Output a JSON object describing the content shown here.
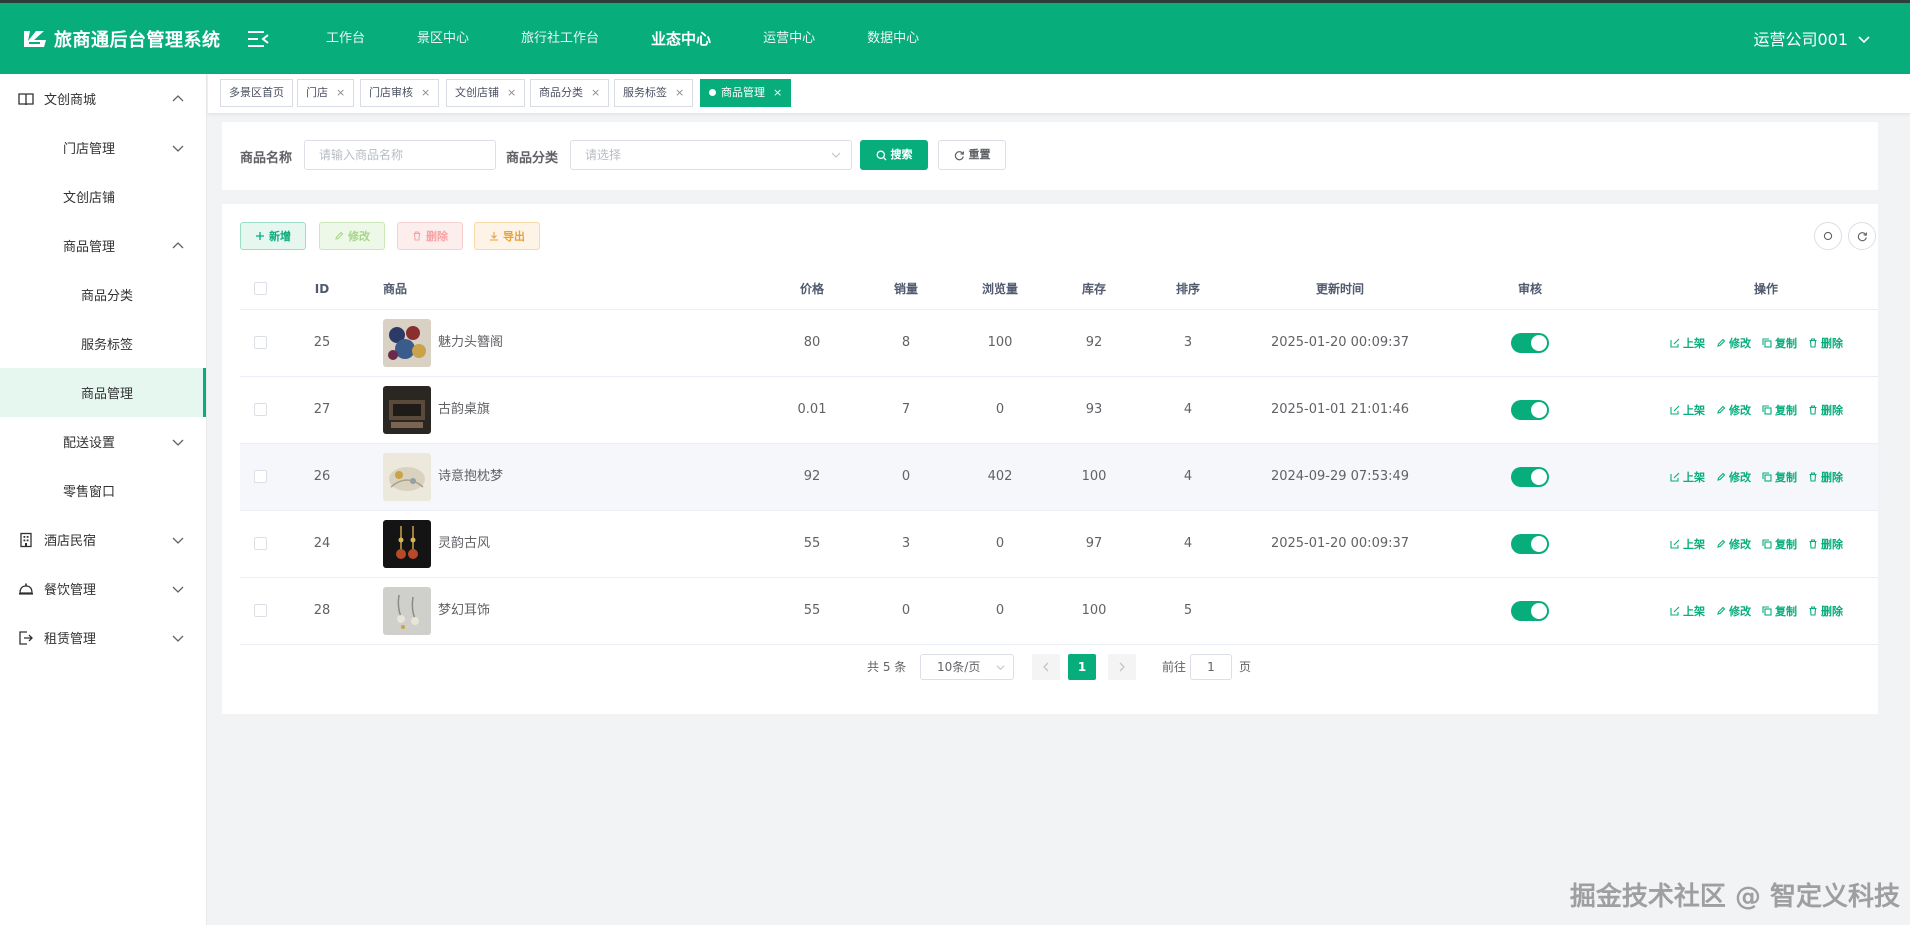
{
  "app": {
    "title": "旅商通后台管理系统",
    "user": "运营公司001"
  },
  "colors": {
    "brand": "#08ad7c",
    "topbar": "#08ad7c"
  },
  "topnav": [
    "工作台",
    "景区中心",
    "旅行社工作台",
    "业态中心",
    "运营中心",
    "数据中心"
  ],
  "topnav_active": "业态中心",
  "sidebar": {
    "items": [
      {
        "label": "文创商城",
        "icon": "book-icon"
      },
      {
        "label": "门店管理"
      },
      {
        "label": "文创店铺"
      },
      {
        "label": "商品管理"
      },
      {
        "label": "商品分类"
      },
      {
        "label": "服务标签"
      },
      {
        "label": "商品管理"
      },
      {
        "label": "配送设置"
      },
      {
        "label": "零售窗口"
      },
      {
        "label": "酒店民宿",
        "icon": "building-icon"
      },
      {
        "label": "餐饮管理",
        "icon": "dining-bell-icon"
      },
      {
        "label": "租赁管理",
        "icon": "logout-box-icon"
      }
    ]
  },
  "tabs": [
    "多景区首页",
    "门店",
    "门店审核",
    "文创店铺",
    "商品分类",
    "服务标签",
    "商品管理"
  ],
  "search": {
    "name_label": "商品名称",
    "name_placeholder": "请输入商品名称",
    "category_label": "商品分类",
    "category_placeholder": "请选择",
    "search_button": "搜索",
    "reset_button": "重置"
  },
  "toolbar": {
    "add": "新增",
    "edit": "修改",
    "delete": "删除",
    "export": "导出"
  },
  "table": {
    "columns": [
      "ID",
      "商品",
      "价格",
      "销量",
      "浏览量",
      "库存",
      "排序",
      "更新时间",
      "审核",
      "操作"
    ],
    "rows": [
      {
        "id": "25",
        "name": "魅力头簪阁",
        "price": "80",
        "sales": "8",
        "views": "100",
        "stock": "92",
        "sort": "3",
        "updated": "2025-01-20 00:09:37",
        "approved": true
      },
      {
        "id": "27",
        "name": "古韵桌旗",
        "price": "0.01",
        "sales": "7",
        "views": "0",
        "stock": "93",
        "sort": "4",
        "updated": "2025-01-01 21:01:46",
        "approved": true
      },
      {
        "id": "26",
        "name": "诗意抱枕梦",
        "price": "92",
        "sales": "0",
        "views": "402",
        "stock": "100",
        "sort": "4",
        "updated": "2024-09-29 07:53:49",
        "approved": true
      },
      {
        "id": "24",
        "name": "灵韵古风",
        "price": "55",
        "sales": "3",
        "views": "0",
        "stock": "97",
        "sort": "4",
        "updated": "2025-01-20 00:09:37",
        "approved": true
      },
      {
        "id": "28",
        "name": "梦幻耳饰",
        "price": "55",
        "sales": "0",
        "views": "0",
        "stock": "100",
        "sort": "5",
        "updated": "",
        "approved": true
      }
    ],
    "row_actions": [
      "上架",
      "修改",
      "复制",
      "删除"
    ]
  },
  "pagination": {
    "total": "共 5 条",
    "page_size": "10条/页",
    "current": "1",
    "goto_label": "前往",
    "goto_value": "1",
    "goto_unit": "页"
  },
  "watermark": "掘金技术社区 @ 智定义科技"
}
